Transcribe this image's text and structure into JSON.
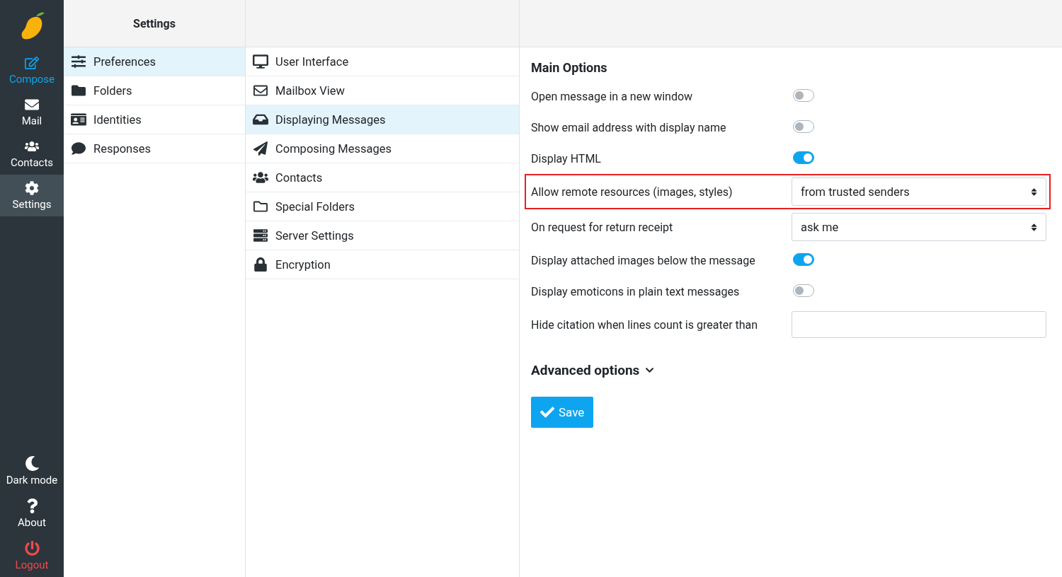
{
  "nav": {
    "top": [
      {
        "label": "Compose",
        "color": "#0ea5f0",
        "selected": false
      },
      {
        "label": "Mail",
        "color": "#ffffff",
        "selected": false
      },
      {
        "label": "Contacts",
        "color": "#ffffff",
        "selected": false
      },
      {
        "label": "Settings",
        "color": "#ffffff",
        "selected": true
      }
    ],
    "bottom": [
      {
        "label": "Dark mode",
        "color": "#ffffff"
      },
      {
        "label": "About",
        "color": "#ffffff"
      },
      {
        "label": "Logout",
        "color": "#f04a4a"
      }
    ]
  },
  "settings_menu": {
    "title": "Settings",
    "items": [
      {
        "label": "Preferences",
        "selected": true
      },
      {
        "label": "Folders",
        "selected": false
      },
      {
        "label": "Identities",
        "selected": false
      },
      {
        "label": "Responses",
        "selected": false
      }
    ]
  },
  "sections": {
    "items": [
      {
        "label": "User Interface",
        "selected": false
      },
      {
        "label": "Mailbox View",
        "selected": false
      },
      {
        "label": "Displaying Messages",
        "selected": true
      },
      {
        "label": "Composing Messages",
        "selected": false
      },
      {
        "label": "Contacts",
        "selected": false
      },
      {
        "label": "Special Folders",
        "selected": false
      },
      {
        "label": "Server Settings",
        "selected": false
      },
      {
        "label": "Encryption",
        "selected": false
      }
    ]
  },
  "form": {
    "title": "Main Options",
    "options": [
      {
        "kind": "toggle",
        "label": "Open message in a new window",
        "on": false,
        "highlighted": false
      },
      {
        "kind": "toggle",
        "label": "Show email address with display name",
        "on": false,
        "highlighted": false
      },
      {
        "kind": "toggle",
        "label": "Display HTML",
        "on": true,
        "highlighted": false
      },
      {
        "kind": "select",
        "label": "Allow remote resources (images, styles)",
        "value": "from trusted senders",
        "highlighted": true
      },
      {
        "kind": "select",
        "label": "On request for return receipt",
        "value": "ask me",
        "highlighted": false
      },
      {
        "kind": "toggle",
        "label": "Display attached images below the message",
        "on": true,
        "highlighted": false
      },
      {
        "kind": "toggle",
        "label": "Display emoticons in plain text messages",
        "on": false,
        "highlighted": false
      },
      {
        "kind": "text",
        "label": "Hide citation when lines count is greater than",
        "highlighted": false
      }
    ],
    "advanced": "Advanced options",
    "save": "Save"
  }
}
